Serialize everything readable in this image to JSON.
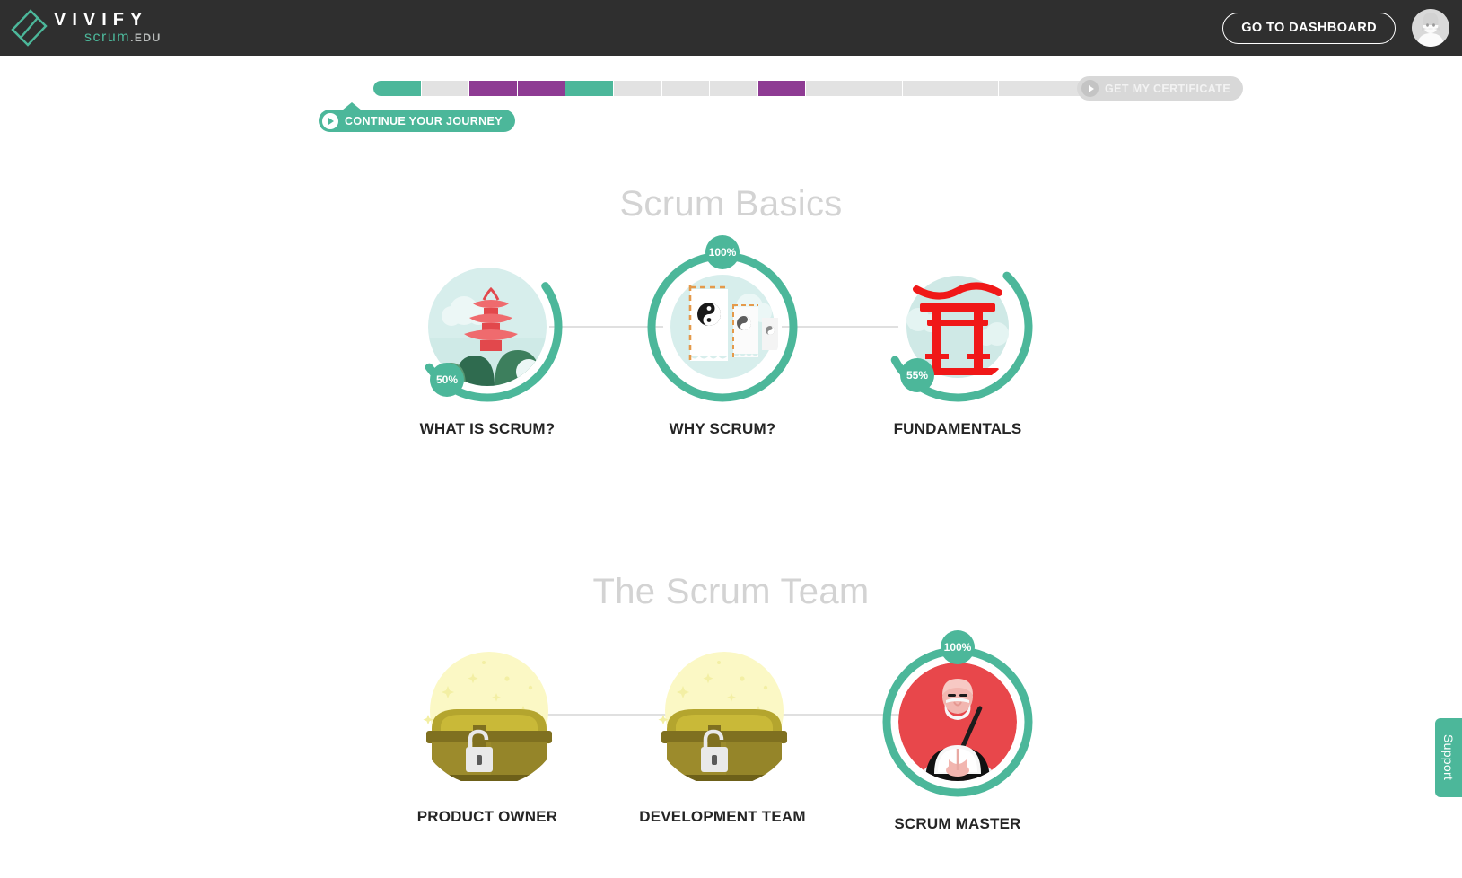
{
  "brand": {
    "name_top": "VIVIFY",
    "name_scrum": "scrum",
    "name_edu": ".EDU",
    "logo_icon": "checkmark-document-icon",
    "accent_teal": "#4cb79a",
    "accent_purple": "#8e3b93",
    "topbar_bg": "#2f2f2f"
  },
  "topbar": {
    "dashboard_button": "GO TO DASHBOARD",
    "avatar_icon": "user-avatar-icon"
  },
  "progress": {
    "continue_label": "CONTINUE YOUR JOURNEY",
    "continue_icon": "play-icon",
    "certificate_label": "GET MY CERTIFICATE",
    "certificate_icon": "play-icon",
    "certificate_enabled": false,
    "total_segments": 17,
    "segments": [
      "teal",
      "empty",
      "purple",
      "purple",
      "teal",
      "empty",
      "empty",
      "empty",
      "purple",
      "empty",
      "empty",
      "empty",
      "empty",
      "empty",
      "empty",
      "empty",
      "empty"
    ]
  },
  "sections": [
    {
      "title": "Scrum Basics",
      "nodes": [
        {
          "label": "WHAT IS SCRUM?",
          "percent": 50,
          "percent_label": "50%",
          "badge_position": "bottom-left",
          "art": "pagoda-illustration",
          "locked": false
        },
        {
          "label": "WHY SCRUM?",
          "percent": 100,
          "percent_label": "100%",
          "badge_position": "top",
          "art": "yin-yang-banners-illustration",
          "locked": false
        },
        {
          "label": "FUNDAMENTALS",
          "percent": 55,
          "percent_label": "55%",
          "badge_position": "bottom-left",
          "art": "torii-gate-illustration",
          "locked": false
        }
      ]
    },
    {
      "title": "The Scrum Team",
      "nodes": [
        {
          "label": "PRODUCT OWNER",
          "percent": 0,
          "percent_label": "",
          "badge_position": "none",
          "art": "locked-treasure-chest-illustration",
          "locked": true
        },
        {
          "label": "DEVELOPMENT TEAM",
          "percent": 0,
          "percent_label": "",
          "badge_position": "none",
          "art": "locked-treasure-chest-illustration",
          "locked": true
        },
        {
          "label": "SCRUM MASTER",
          "percent": 100,
          "percent_label": "100%",
          "badge_position": "top",
          "art": "sensei-master-illustration",
          "locked": false
        }
      ]
    }
  ],
  "support": {
    "label": "Support"
  }
}
